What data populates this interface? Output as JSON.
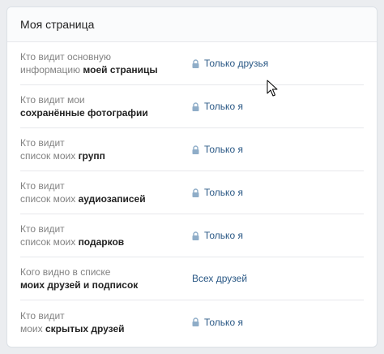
{
  "card": {
    "title": "Моя страница"
  },
  "rows": [
    {
      "line1_plain": "Кто видит основную",
      "line2_plain": "информацию ",
      "line2_strong": "моей страницы",
      "value": "Только друзья",
      "locked": true
    },
    {
      "line1_plain": "Кто видит мои",
      "line2_plain": "",
      "line2_strong": "сохранённые фотографии",
      "value": "Только я",
      "locked": true
    },
    {
      "line1_plain": "Кто видит",
      "line2_plain": "список моих ",
      "line2_strong": "групп",
      "value": "Только я",
      "locked": true
    },
    {
      "line1_plain": "Кто видит",
      "line2_plain": "список моих ",
      "line2_strong": "аудиозаписей",
      "value": "Только я",
      "locked": true
    },
    {
      "line1_plain": "Кто видит",
      "line2_plain": "список моих ",
      "line2_strong": "подарков",
      "value": "Только я",
      "locked": true
    },
    {
      "line1_plain": "Кого видно в списке",
      "line2_plain": "",
      "line2_strong": "моих друзей и подписок",
      "value": "Всех друзей",
      "locked": false
    },
    {
      "line1_plain": "Кто видит",
      "line2_plain": "моих ",
      "line2_strong": "скрытых друзей",
      "value": "Только я",
      "locked": true
    }
  ],
  "icons": {
    "lock": "lock-icon",
    "cursor": "mouse-cursor-icon"
  },
  "colors": {
    "link": "#2a5885",
    "label": "#828282",
    "strong": "#222222",
    "lock": "#8fadc8"
  }
}
